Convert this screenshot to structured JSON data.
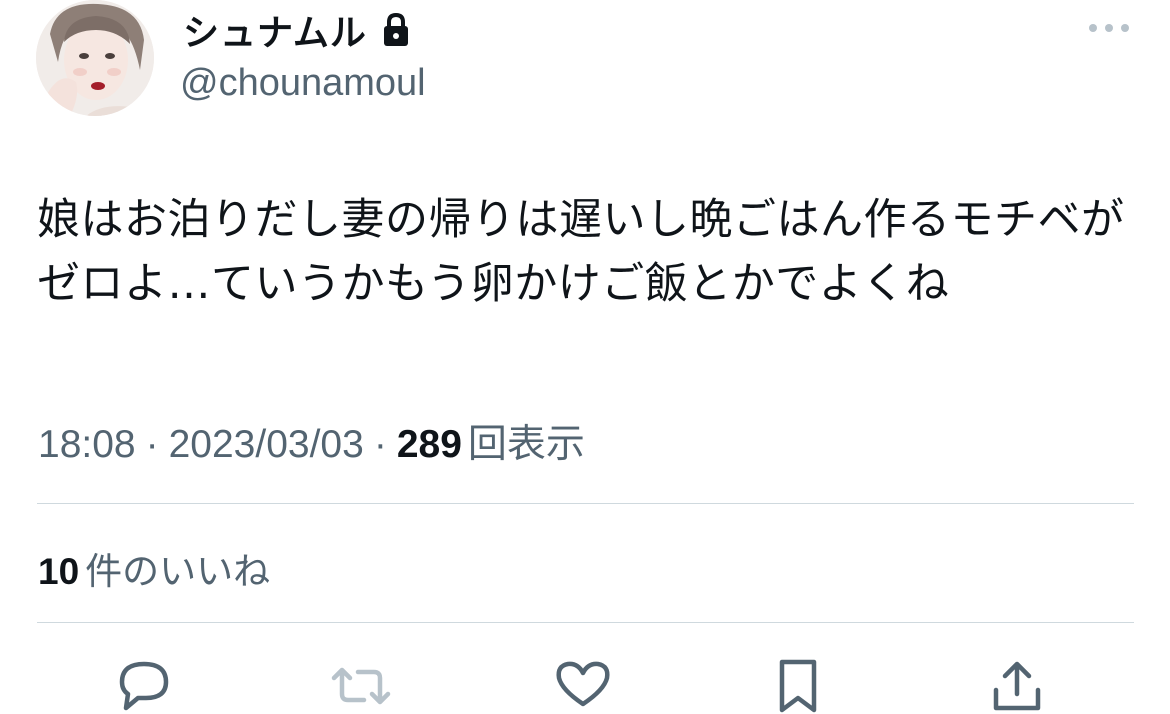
{
  "user": {
    "display_name": "シュナムル",
    "handle": "@chounamoul",
    "avatar_icon": "avatar-illustration",
    "protected_icon": "lock-icon"
  },
  "tweet": {
    "text": "娘はお泊りだし妻の帰りは遅いし晩ごはん作るモチベがゼロよ…ていうかもう卵かけご飯とかでよくね",
    "time": "18:08",
    "separator": "·",
    "date": "2023/03/03",
    "views_count": "289",
    "views_label": "回表示"
  },
  "engagement": {
    "likes_count": "10",
    "likes_label": "件のいいね"
  },
  "actions": [
    {
      "icon": "reply-icon"
    },
    {
      "icon": "retweet-icon"
    },
    {
      "icon": "like-icon"
    },
    {
      "icon": "bookmark-icon"
    },
    {
      "icon": "share-icon"
    }
  ],
  "colors": {
    "text_primary": "#0f1419",
    "text_secondary": "#536471",
    "divider": "#cfd9de",
    "icon_disabled": "#b7c2ca"
  }
}
